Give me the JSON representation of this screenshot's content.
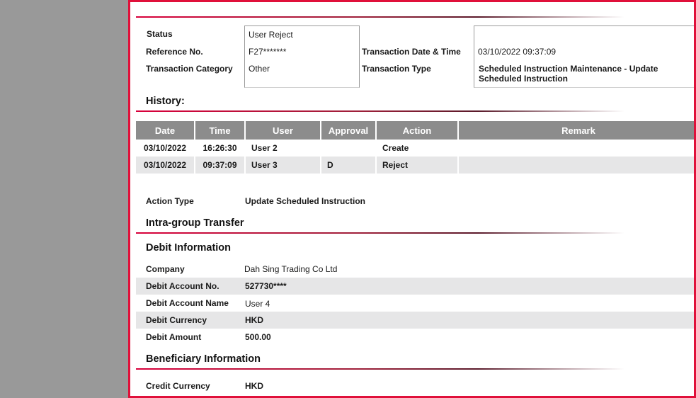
{
  "summary": {
    "status_label": "Status",
    "status_value": "User Reject",
    "reference_label": "Reference No.",
    "reference_value": "F27*******",
    "category_label": "Transaction Category",
    "category_value": "Other",
    "datetime_label": "Transaction Date & Time",
    "datetime_value": "03/10/2022 09:37:09",
    "type_label": "Transaction Type",
    "type_value_line1": "Scheduled Instruction Maintenance - Update",
    "type_value_line2": "Scheduled Instruction"
  },
  "history": {
    "title": "History:",
    "columns": [
      "Date",
      "Time",
      "User",
      "Approval",
      "Action",
      "Remark"
    ],
    "rows": [
      [
        "03/10/2022",
        "16:26:30",
        "User 2",
        "",
        "Create",
        ""
      ],
      [
        "03/10/2022",
        "09:37:09",
        "User 3",
        "D",
        "Reject",
        ""
      ]
    ]
  },
  "action": {
    "label": "Action Type",
    "value": "Update Scheduled Instruction"
  },
  "transfer_title": "Intra-group Transfer",
  "debit": {
    "title": "Debit Information",
    "company_label": "Company",
    "company_value": "Dah Sing Trading Co Ltd",
    "account_no_label": "Debit Account No.",
    "account_no_value": "527730****",
    "account_name_label": "Debit Account Name",
    "account_name_value": "User 4",
    "currency_label": "Debit Currency",
    "currency_value": "HKD",
    "amount_label": "Debit Amount",
    "amount_value": "500.00"
  },
  "beneficiary": {
    "title": "Beneficiary Information",
    "currency_label": "Credit Currency",
    "currency_value": "HKD"
  },
  "colors": {
    "frame_border": "#e0103a",
    "table_header": "#8c8c8c",
    "row_stripe": "#e6e6e7",
    "left_panel": "#999999"
  }
}
